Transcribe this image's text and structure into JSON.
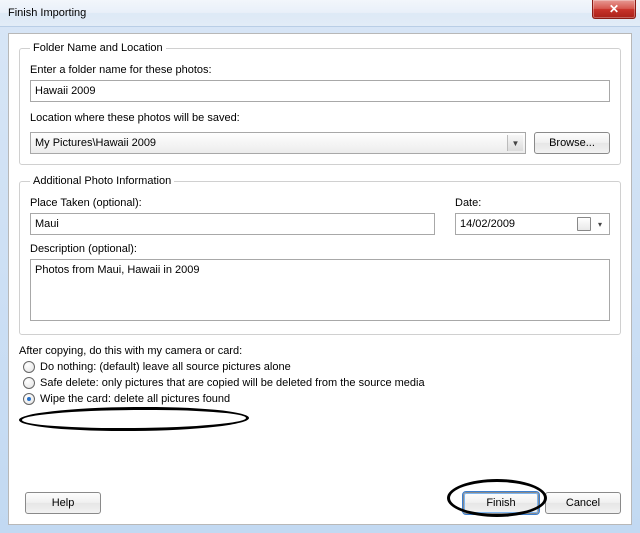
{
  "title": "Finish Importing",
  "close_glyph": "✕",
  "folder": {
    "legend": "Folder Name and Location",
    "name_label": "Enter a folder name for these photos:",
    "name_value": "Hawaii 2009",
    "location_label": "Location where these photos will be saved:",
    "location_value": "My Pictures\\Hawaii 2009",
    "browse": "Browse..."
  },
  "info": {
    "legend": "Additional Photo Information",
    "place_label": "Place Taken (optional):",
    "place_value": "Maui",
    "date_label": "Date:",
    "date_value": "14/02/2009",
    "desc_label": "Description (optional):",
    "desc_value": "Photos from Maui, Hawaii in 2009"
  },
  "after": {
    "label": "After copying, do this with my camera or card:",
    "opt1": "Do nothing: (default) leave all source pictures alone",
    "opt2": "Safe delete: only pictures that are copied will be deleted from the source media",
    "opt3": "Wipe the card: delete all pictures found",
    "selected": 3
  },
  "buttons": {
    "help": "Help",
    "finish": "Finish",
    "cancel": "Cancel"
  }
}
